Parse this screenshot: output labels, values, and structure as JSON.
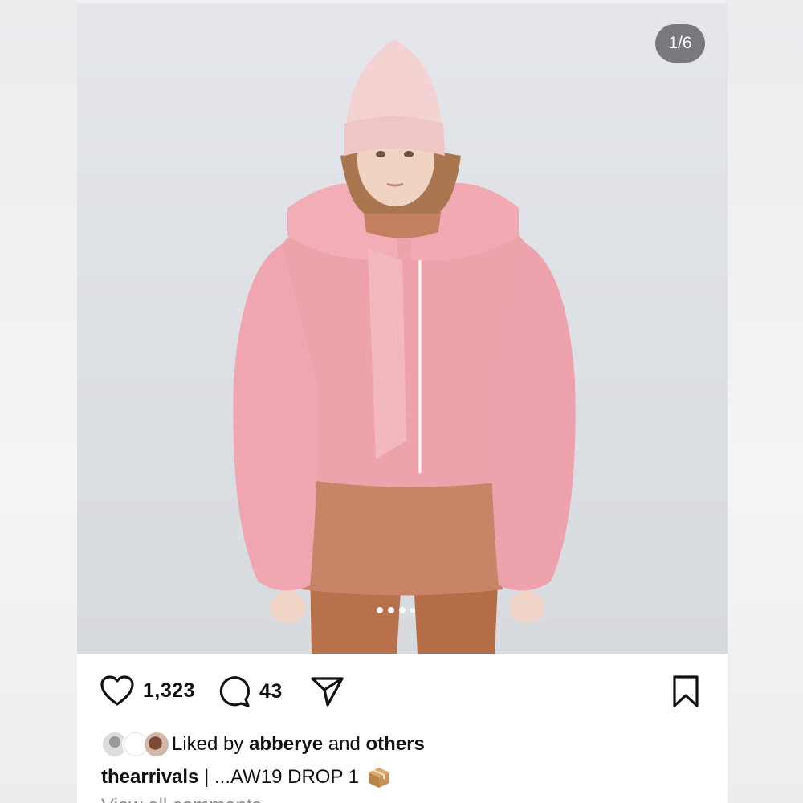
{
  "post": {
    "image_counter": "1/6",
    "carousel": {
      "total_dots": 4,
      "active_index": 0
    },
    "likes_count": "1,323",
    "comments_count": "43",
    "liked_by_prefix": "Liked by ",
    "liked_by_user": "abberye",
    "liked_by_middle": " and ",
    "liked_by_others": "others",
    "caption_user": "thearrivals",
    "caption_text": " | ...AW19 DROP 1",
    "caption_emoji": "package-box-icon",
    "view_comments": "View all comments"
  },
  "colors": {
    "text_primary": "#111111",
    "text_secondary": "#8e8e8e",
    "counter_bg": "#69696e"
  }
}
